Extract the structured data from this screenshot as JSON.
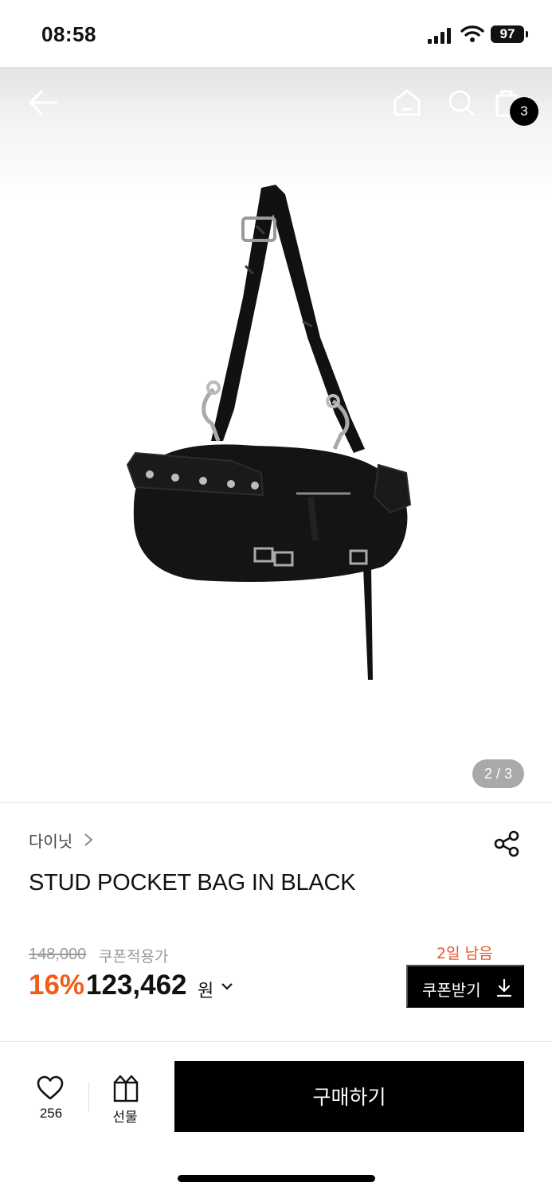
{
  "status_bar": {
    "time": "08:58",
    "battery": "97"
  },
  "header": {
    "cart_count": "3"
  },
  "gallery": {
    "pager": "2 / 3"
  },
  "product": {
    "brand": "다이닛",
    "title": "STUD POCKET BAG IN BLACK",
    "original_price": "148,000",
    "coupon_label": "쿠폰적용가",
    "discount": "16%",
    "price": "123,462",
    "currency": "원",
    "days_left": "2일 남음",
    "coupon_button": "쿠폰받기"
  },
  "bottom_bar": {
    "likes": "256",
    "gift_label": "선물",
    "buy_label": "구매하기"
  },
  "colors": {
    "accent": "#f25c19",
    "days_left": "#e4572a",
    "primary": "#000000"
  }
}
